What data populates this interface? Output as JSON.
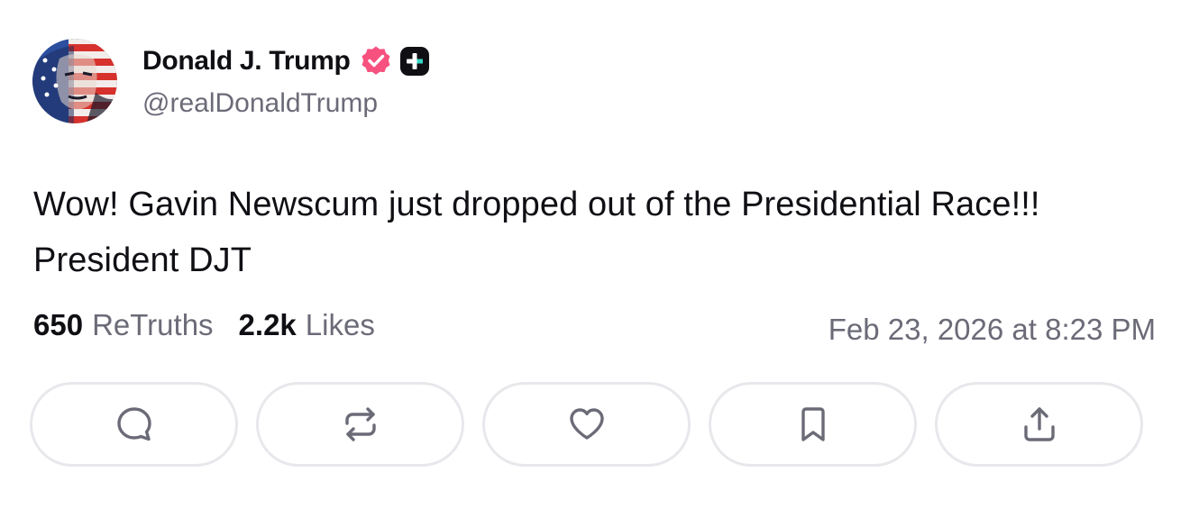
{
  "author": {
    "display_name": "Donald J. Trump",
    "handle": "@realDonaldTrump",
    "verified_color": "#f7517f",
    "badge": "plus-badge-icon"
  },
  "post": {
    "text": "Wow! Gavin Newscum just dropped out of the Presidential Race!!! President DJT"
  },
  "stats": {
    "retruths_count": "650",
    "retruths_label": "ReTruths",
    "likes_count": "2.2k",
    "likes_label": "Likes"
  },
  "timestamp": "Feb 23, 2026 at 8:23 PM",
  "actions": [
    {
      "icon": "reply-icon"
    },
    {
      "icon": "retruth-icon"
    },
    {
      "icon": "like-heart-icon"
    },
    {
      "icon": "bookmark-icon"
    },
    {
      "icon": "share-icon"
    }
  ],
  "colors": {
    "text_primary": "#0f0f14",
    "text_secondary": "#6b6b78",
    "button_border": "#e8e8ec",
    "icon_color": "#6b6b78"
  }
}
